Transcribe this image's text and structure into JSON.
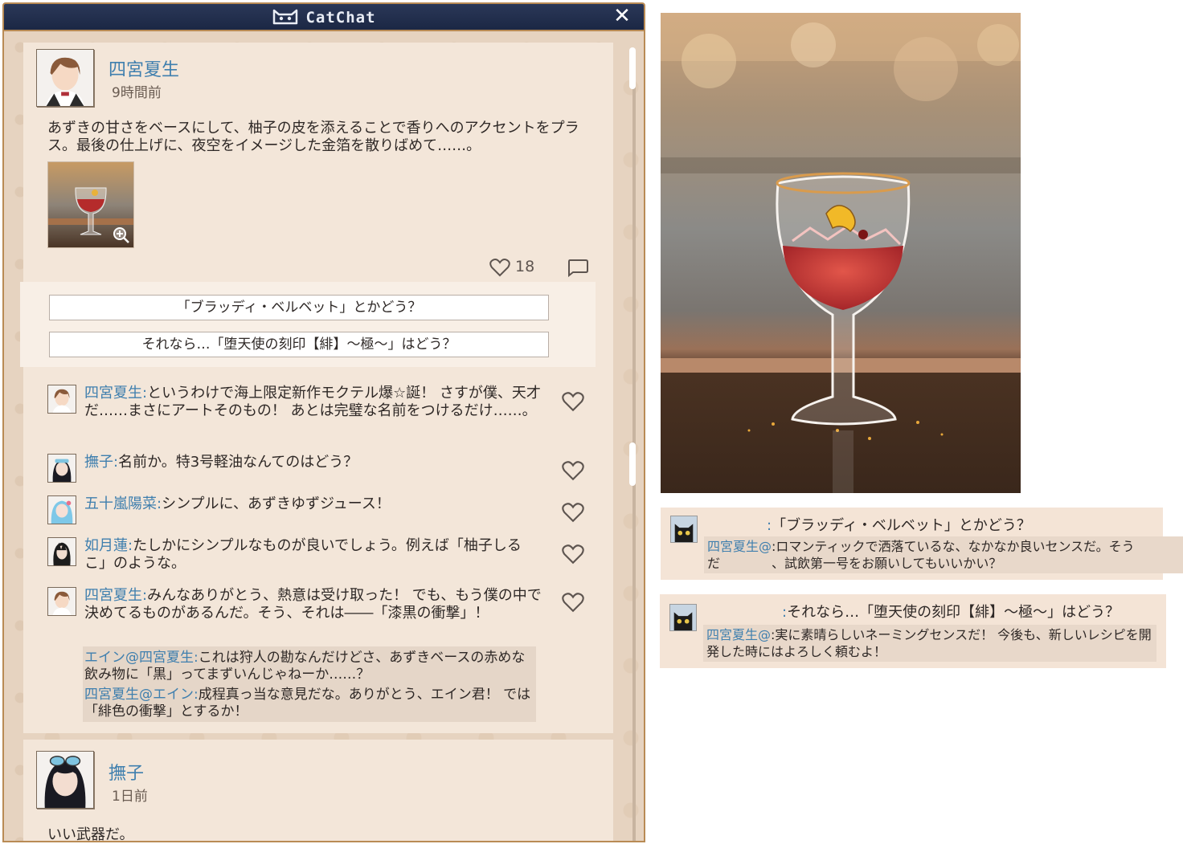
{
  "app": {
    "title": "CatChat"
  },
  "post1": {
    "author": "四宮夏生",
    "time": "9時間前",
    "text": "あずきの甘さをベースにして、柚子の皮を添えることで香りへのアクセントをプラス。最後の仕上げに、夜空をイメージした金箔を散りばめて……。",
    "likes": "18",
    "choices": [
      "「ブラッディ・ベルベット」とかどう？",
      "それなら…「堕天使の刻印【緋】～極～」はどう？"
    ],
    "comments": [
      {
        "name": "四宮夏生:",
        "text": "というわけで海上限定新作モクテル爆☆誕！ さすが僕、天才だ……まさにアートそのもの！ あとは完璧な名前をつけるだけ……。"
      },
      {
        "name": "撫子:",
        "text": "名前か。特3号軽油なんてのはどう？"
      },
      {
        "name": "五十嵐陽菜:",
        "text": "シンプルに、あずきゆずジュース！"
      },
      {
        "name": "如月蓮:",
        "text": "たしかにシンプルなものが良いでしょう。例えば「柚子しるこ」のような。"
      },
      {
        "name": "四宮夏生:",
        "text": "みんなありがとう、熱意は受け取った！ でも、もう僕の中で決めてるものがあるんだ。そう、それは――「漆黒の衝撃」！"
      }
    ],
    "replies": [
      {
        "name": "エイン@四宮夏生:",
        "text": "これは狩人の勘なんだけどさ、あずきベースの赤めな飲み物に「黒」ってまずいんじゃねーか……？"
      },
      {
        "name": "四宮夏生@エイン:",
        "text": "成程真っ当な意見だな。ありがとう、エイン君！ では「緋色の衝撃」とするか！"
      }
    ]
  },
  "post2": {
    "author": "撫子",
    "time": "1日前",
    "text": "いい武器だ。"
  },
  "log": [
    {
      "colon": ":",
      "line": "「ブラッディ・ベルベット」とかどう？",
      "reply_name": "四宮夏生@",
      "reply_text": ":ロマンティックで洒落ているな、なかなか良いセンスだ。そうだ　　　　、試飲第一号をお願いしてもいいかい？"
    },
    {
      "colon": ":",
      "line": "それなら…「堕天使の刻印【緋】～極～」はどう？",
      "reply_name": "四宮夏生@",
      "reply_text": ":実に素晴らしいネーミングセンスだ！ 今後も、新しいレシピを開発した時にはよろしく頼むよ！"
    }
  ],
  "colors": {
    "accent_name": "#3f7fae",
    "titlebar": "#1b2744",
    "frame": "#b98b55"
  }
}
